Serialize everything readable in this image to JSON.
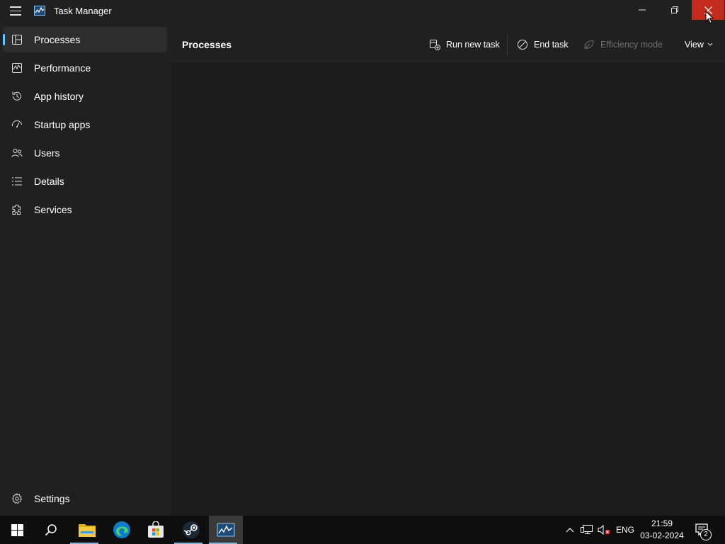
{
  "window": {
    "title": "Task Manager"
  },
  "sidebar": {
    "items": [
      {
        "label": "Processes",
        "icon": "processes-icon",
        "active": true
      },
      {
        "label": "Performance",
        "icon": "performance-icon"
      },
      {
        "label": "App history",
        "icon": "app-history-icon"
      },
      {
        "label": "Startup apps",
        "icon": "startup-apps-icon"
      },
      {
        "label": "Users",
        "icon": "users-icon"
      },
      {
        "label": "Details",
        "icon": "details-icon"
      },
      {
        "label": "Services",
        "icon": "services-icon"
      }
    ],
    "settings_label": "Settings"
  },
  "main": {
    "title": "Processes",
    "toolbar": {
      "run_new_task": "Run new task",
      "end_task": "End task",
      "efficiency_mode": "Efficiency mode",
      "view": "View"
    }
  },
  "taskbar": {
    "apps": [
      "start-icon",
      "search-icon",
      "file-explorer-icon",
      "edge-icon",
      "store-icon",
      "steam-icon",
      "task-manager-icon"
    ],
    "language": "ENG",
    "time": "21:59",
    "date": "03-02-2024",
    "notification_count": "2"
  },
  "colors": {
    "accent": "#6cc1ff",
    "close_button": "#c42b1c",
    "background": "#202020"
  }
}
